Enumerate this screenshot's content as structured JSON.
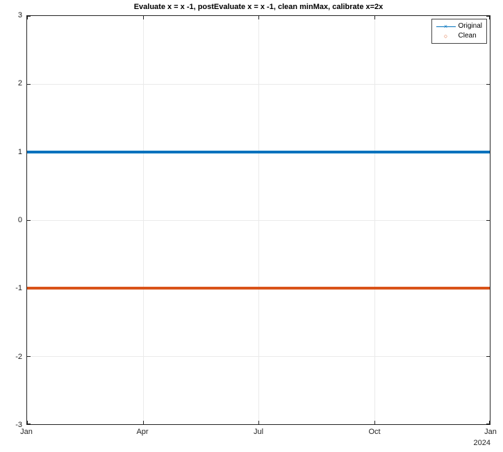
{
  "chart_data": {
    "type": "line",
    "title": "Evaluate x = x -1, postEvaluate x = x -1, clean minMax, calibrate x=2x",
    "xlabel": "",
    "ylabel": "",
    "xlim": [
      "Jan",
      "Jan"
    ],
    "ylim": [
      -3,
      3
    ],
    "x_ticks": [
      "Jan",
      "Apr",
      "Jul",
      "Oct",
      "Jan"
    ],
    "y_ticks": [
      -3,
      -2,
      -1,
      0,
      1,
      2,
      3
    ],
    "x_year_label": "2024",
    "series": [
      {
        "name": "Original",
        "color": "#0072bd",
        "marker": "×",
        "values": [
          1,
          1,
          1,
          1,
          1
        ]
      },
      {
        "name": "Clean",
        "color": "#d95319",
        "marker": "○",
        "values": [
          -1,
          -1,
          -1,
          -1,
          -1
        ]
      }
    ],
    "categories": [
      "Jan",
      "Apr",
      "Jul",
      "Oct",
      "Jan"
    ]
  },
  "legend": {
    "items": [
      {
        "label": "Original",
        "color": "#0072bd",
        "marker": "×",
        "has_line": true
      },
      {
        "label": "Clean",
        "color": "#d95319",
        "marker": "○",
        "has_line": false
      }
    ]
  }
}
